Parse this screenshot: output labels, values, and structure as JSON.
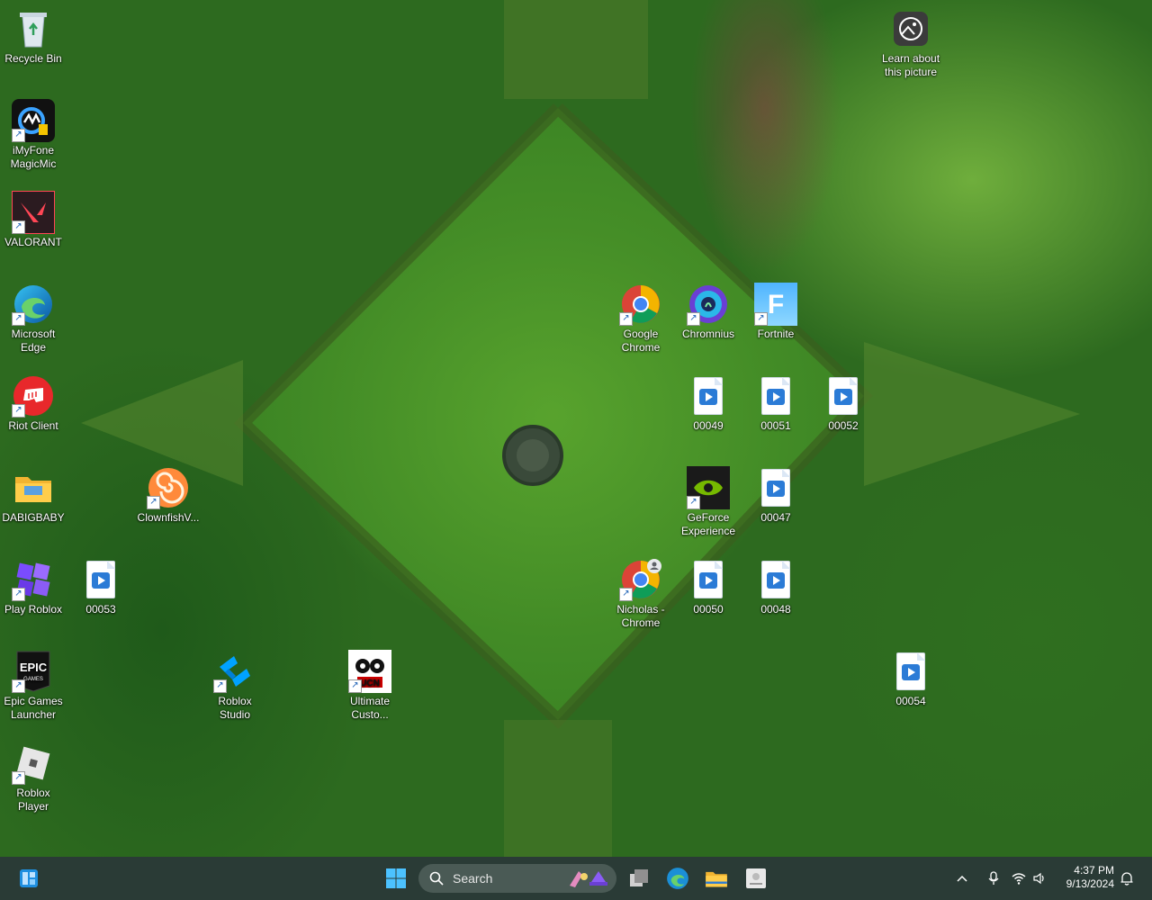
{
  "desktop": {
    "icons": [
      {
        "label": "Recycle Bin",
        "icon": "recycle-bin-icon"
      },
      {
        "label": "Learn about\nthis picture",
        "icon": "learn-picture-icon"
      },
      {
        "label": "iMyFone\nMagicMic",
        "icon": "imyfone-magicmic-icon"
      },
      {
        "label": "VALORANT",
        "icon": "valorant-icon"
      },
      {
        "label": "Microsoft\nEdge",
        "icon": "edge-icon"
      },
      {
        "label": "Google\nChrome",
        "icon": "chrome-icon"
      },
      {
        "label": "Chromnius",
        "icon": "chromnius-icon"
      },
      {
        "label": "Fortnite",
        "icon": "fortnite-icon"
      },
      {
        "label": "Riot Client",
        "icon": "riot-client-icon"
      },
      {
        "label": "00049",
        "icon": "video-file-icon"
      },
      {
        "label": "00051",
        "icon": "video-file-icon"
      },
      {
        "label": "00052",
        "icon": "video-file-icon"
      },
      {
        "label": "DABIGBABY",
        "icon": "folder-icon"
      },
      {
        "label": "ClownfishV...",
        "icon": "clownfish-icon"
      },
      {
        "label": "GeForce\nExperience",
        "icon": "geforce-icon"
      },
      {
        "label": "00047",
        "icon": "video-file-icon"
      },
      {
        "label": "Play Roblox",
        "icon": "play-roblox-icon"
      },
      {
        "label": "00053",
        "icon": "video-file-icon"
      },
      {
        "label": "Nicholas -\nChrome",
        "icon": "chrome-profile-icon"
      },
      {
        "label": "00050",
        "icon": "video-file-icon"
      },
      {
        "label": "00048",
        "icon": "video-file-icon"
      },
      {
        "label": "Epic Games\nLauncher",
        "icon": "epic-games-icon"
      },
      {
        "label": "Roblox\nStudio",
        "icon": "roblox-studio-icon"
      },
      {
        "label": "Ultimate\nCusto...",
        "icon": "ultimate-custom-icon"
      },
      {
        "label": "00054",
        "icon": "video-file-icon"
      },
      {
        "label": "Roblox\nPlayer",
        "icon": "roblox-player-icon"
      }
    ]
  },
  "taskbar": {
    "search_label": "Search",
    "time": "4:37 PM",
    "date": "9/13/2024"
  },
  "colors": {
    "taskbar_bg": "#2a3b36",
    "accent": "#0078d4"
  }
}
